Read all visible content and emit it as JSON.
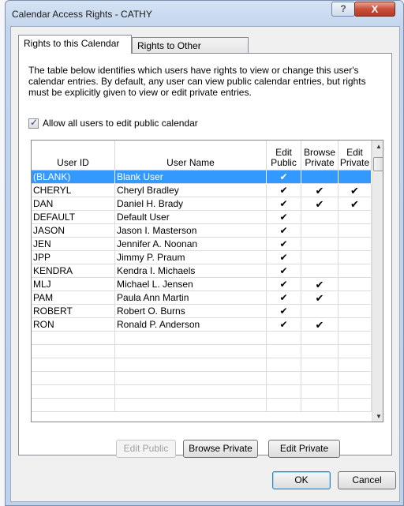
{
  "window": {
    "title": "Calendar Access Rights - CATHY",
    "help_label": "?",
    "close_label": "X"
  },
  "tabs": [
    {
      "label": "Rights to this Calendar",
      "active": true
    },
    {
      "label": "Rights to Other Calendars",
      "active": false
    }
  ],
  "description": "The table below identifies which users have rights to view or change this user's calendar entries.  By default, any user can view public calendar entries, but rights must be explicitly given to view or edit private entries.",
  "allow_all": {
    "label": "Allow all users to edit public calendar",
    "checked": true
  },
  "grid": {
    "headers": {
      "user_id": "User ID",
      "user_name": "User Name",
      "edit_public": "Edit Public",
      "browse_private": "Browse Private",
      "edit_private": "Edit Private"
    },
    "check_glyph": "✔",
    "rows": [
      {
        "user_id": "(BLANK)",
        "user_name": "Blank User",
        "edit_public": "✔",
        "browse_private": "",
        "edit_private": "",
        "selected": true
      },
      {
        "user_id": "CHERYL",
        "user_name": "Cheryl Bradley",
        "edit_public": "✔",
        "browse_private": "✔",
        "edit_private": "✔"
      },
      {
        "user_id": "DAN",
        "user_name": "Daniel H. Brady",
        "edit_public": "✔",
        "browse_private": "✔",
        "edit_private": "✔"
      },
      {
        "user_id": "DEFAULT",
        "user_name": "Default User",
        "edit_public": "✔",
        "browse_private": "",
        "edit_private": ""
      },
      {
        "user_id": "JASON",
        "user_name": "Jason I. Masterson",
        "edit_public": "✔",
        "browse_private": "",
        "edit_private": ""
      },
      {
        "user_id": "JEN",
        "user_name": "Jennifer A. Noonan",
        "edit_public": "✔",
        "browse_private": "",
        "edit_private": ""
      },
      {
        "user_id": "JPP",
        "user_name": "Jimmy P. Praum",
        "edit_public": "✔",
        "browse_private": "",
        "edit_private": ""
      },
      {
        "user_id": "KENDRA",
        "user_name": "Kendra I. Michaels",
        "edit_public": "✔",
        "browse_private": "",
        "edit_private": ""
      },
      {
        "user_id": "MLJ",
        "user_name": "Michael L. Jensen",
        "edit_public": "✔",
        "browse_private": "✔",
        "edit_private": ""
      },
      {
        "user_id": "PAM",
        "user_name": "Paula Ann Martin",
        "edit_public": "✔",
        "browse_private": "✔",
        "edit_private": ""
      },
      {
        "user_id": "ROBERT",
        "user_name": "Robert O. Burns",
        "edit_public": "✔",
        "browse_private": "",
        "edit_private": ""
      },
      {
        "user_id": "RON",
        "user_name": "Ronald P. Anderson",
        "edit_public": "✔",
        "browse_private": "✔",
        "edit_private": ""
      }
    ],
    "empty_rows": 6
  },
  "buttons": {
    "edit_public": "Edit Public",
    "browse_private": "Browse Private",
    "edit_private": "Edit Private",
    "ok": "OK",
    "cancel": "Cancel"
  },
  "colors": {
    "selection": "#3399ff",
    "close_button": "#c9503a"
  }
}
